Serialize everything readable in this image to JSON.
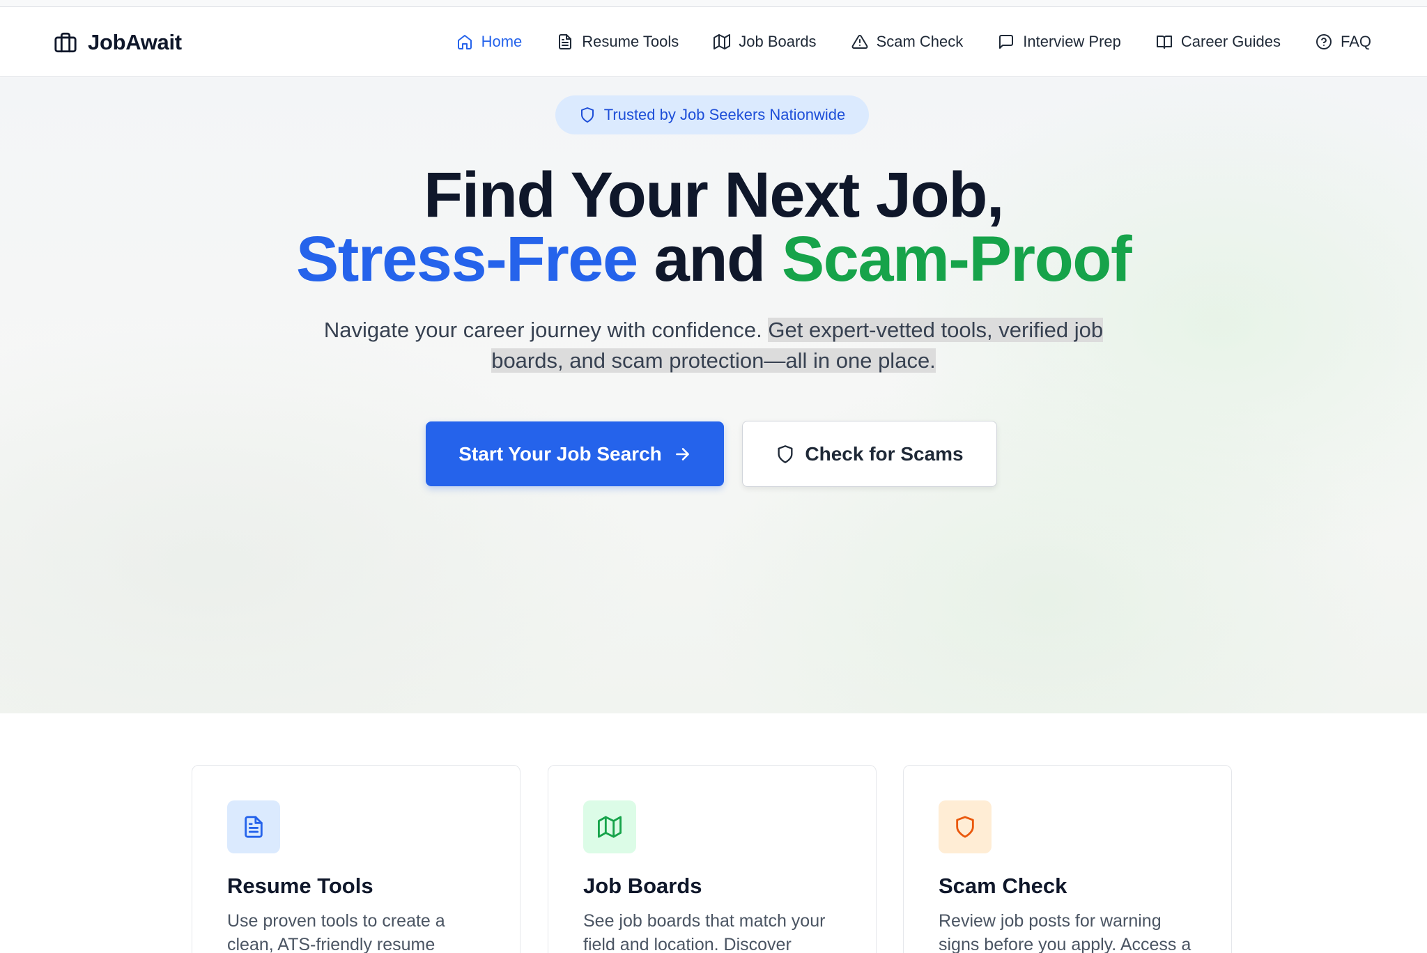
{
  "brand": {
    "name": "JobAwait"
  },
  "nav": {
    "items": [
      {
        "label": "Home",
        "icon": "home-icon",
        "active": true
      },
      {
        "label": "Resume Tools",
        "icon": "document-icon"
      },
      {
        "label": "Job Boards",
        "icon": "map-icon"
      },
      {
        "label": "Scam Check",
        "icon": "warning-icon"
      },
      {
        "label": "Interview Prep",
        "icon": "chat-icon"
      },
      {
        "label": "Career Guides",
        "icon": "book-icon"
      },
      {
        "label": "FAQ",
        "icon": "help-icon"
      }
    ]
  },
  "hero": {
    "badge": "Trusted by Job Seekers Nationwide",
    "headline_line1": "Find Your Next Job,",
    "headline_blue": "Stress-Free",
    "headline_mid": " and ",
    "headline_green": "Scam-Proof",
    "subtitle_plain": "Navigate your career journey with confidence. ",
    "subtitle_highlight": "Get expert-vetted tools, verified job boards, and scam protection—all in one place.",
    "primary_button": "Start Your Job Search",
    "secondary_button": "Check for Scams"
  },
  "cards": [
    {
      "title": "Resume Tools",
      "desc": "Use proven tools to create a clean, ATS-friendly resume",
      "icon": "document-icon",
      "color": "#2563eb",
      "bg": "#dbeafe"
    },
    {
      "title": "Job Boards",
      "desc": "See job boards that match your field and location. Discover",
      "icon": "map-icon",
      "color": "#16a34a",
      "bg": "#dcfce7"
    },
    {
      "title": "Scam Check",
      "desc": "Review job posts for warning signs before you apply. Access a",
      "icon": "shield-icon",
      "color": "#ea580c",
      "bg": "#ffedd5"
    }
  ],
  "colors": {
    "accent": "#2563eb",
    "green": "#16a34a",
    "orange": "#ea580c"
  }
}
